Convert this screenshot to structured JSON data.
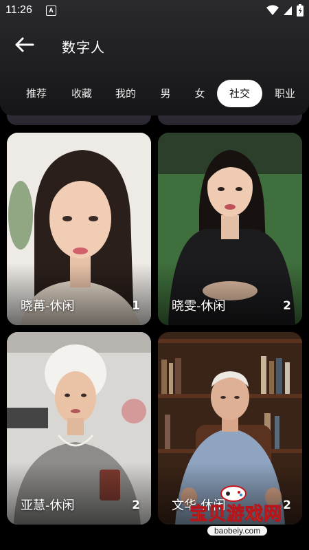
{
  "status_bar": {
    "time": "11:26",
    "notification_glyph": "A",
    "icons": [
      "wifi-icon",
      "signal-icon",
      "battery-icon"
    ]
  },
  "header": {
    "title": "数字人"
  },
  "tabs": [
    {
      "label": "推荐"
    },
    {
      "label": "收藏"
    },
    {
      "label": "我的"
    },
    {
      "label": "男"
    },
    {
      "label": "女"
    },
    {
      "label": "社交",
      "active": true
    },
    {
      "label": "职业"
    }
  ],
  "cards": [
    {
      "label": "晓苒-休闲",
      "count": "1"
    },
    {
      "label": "晓雯-休闲",
      "count": "2"
    },
    {
      "label": "亚慧-休闲",
      "count": "2"
    },
    {
      "label": "文华-休闲",
      "count": "2"
    }
  ],
  "watermark": {
    "text": "宝贝游戏网",
    "url": "baobeiy.com"
  },
  "colors": {
    "active_tab_bg": "#ffffff",
    "header_bg": "#1f1f22",
    "page_bg": "#000000",
    "watermark": "#f0c416"
  }
}
